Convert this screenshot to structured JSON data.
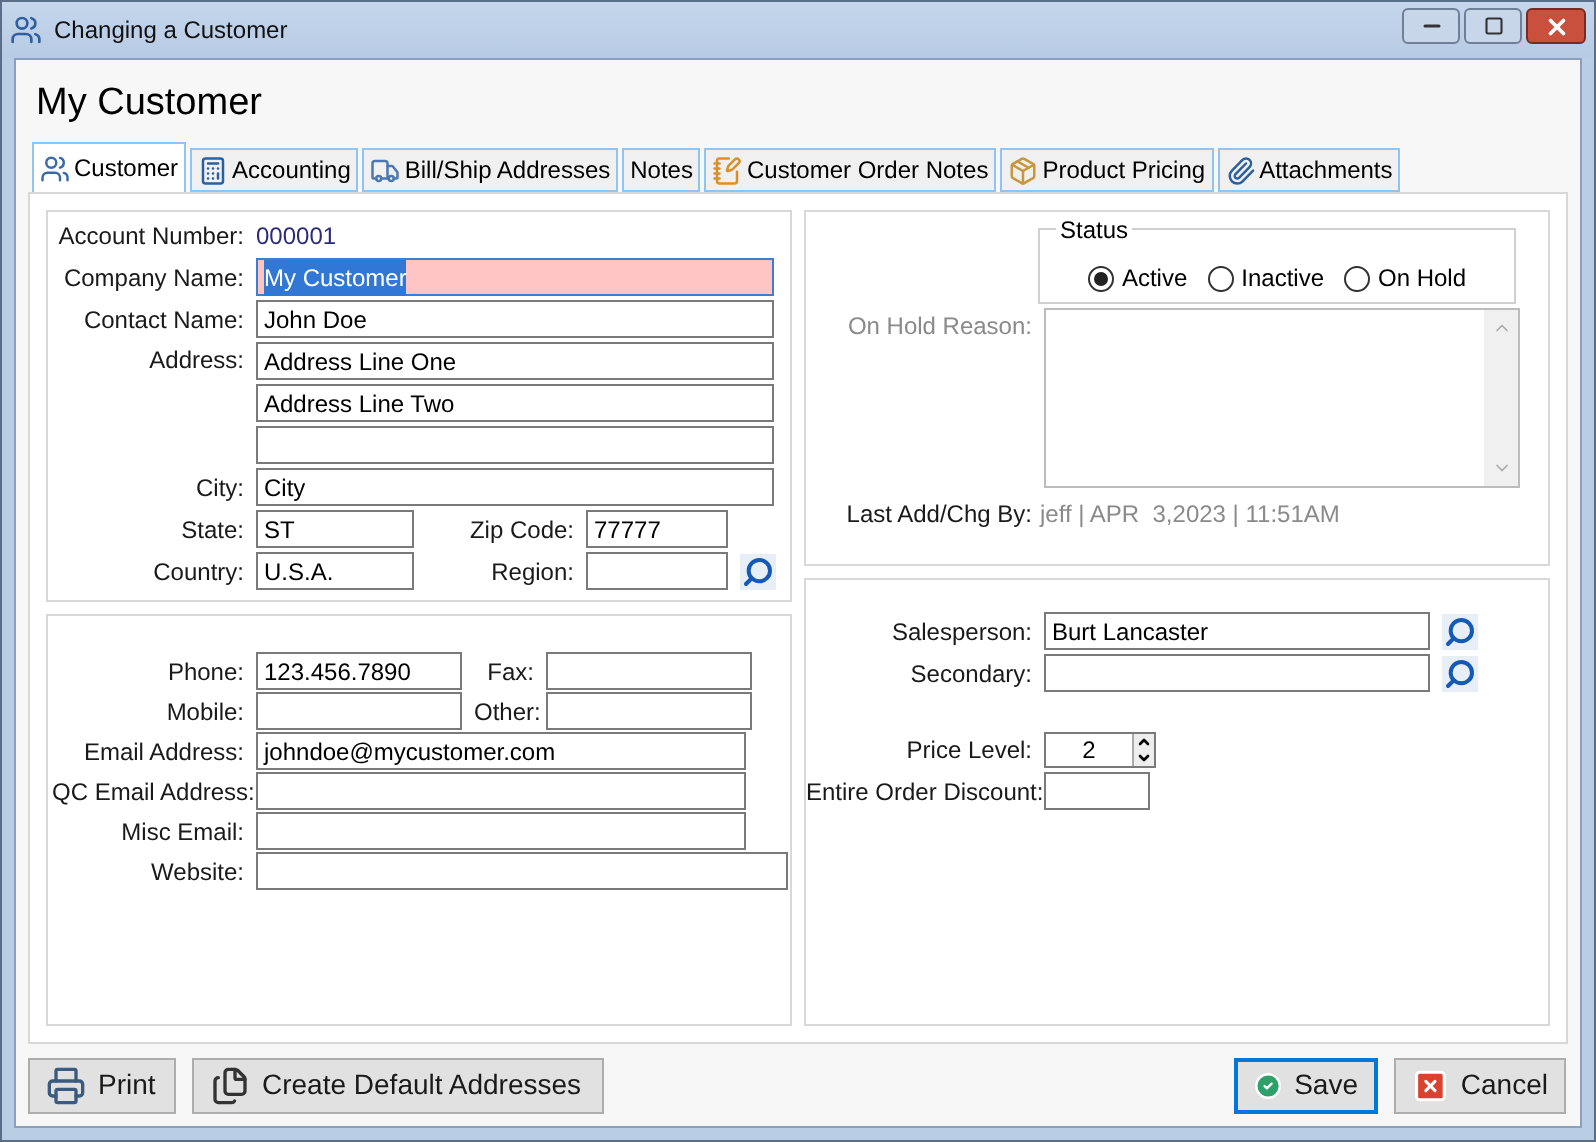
{
  "window": {
    "title": "Changing a Customer"
  },
  "heading": "My Customer",
  "tabs": [
    {
      "label": "Customer",
      "kind": "customer",
      "selected": true
    },
    {
      "label": "Accounting",
      "kind": "accounting",
      "selected": false
    },
    {
      "label": "Bill/Ship Addresses",
      "kind": "addresses",
      "selected": false
    },
    {
      "label": "Notes",
      "kind": "notes",
      "selected": false
    },
    {
      "label": "Customer Order Notes",
      "kind": "order_notes",
      "selected": false
    },
    {
      "label": "Product Pricing",
      "kind": "pricing",
      "selected": false
    },
    {
      "label": "Attachments",
      "kind": "attachments",
      "selected": false
    }
  ],
  "account": {
    "label": "Account Number:",
    "value": "000001"
  },
  "company": {
    "label": "Company Name:",
    "value": "My Customer",
    "focused": true
  },
  "contact": {
    "label": "Contact Name:",
    "value": "John Doe"
  },
  "address": {
    "label": "Address:",
    "lines": [
      {
        "value": "Address Line One"
      },
      {
        "value": "Address Line Two"
      }
    ]
  },
  "city": {
    "label": "City:",
    "value": "City"
  },
  "state": {
    "label": "State:",
    "value": "ST"
  },
  "zip": {
    "label": "Zip Code:",
    "value": "77777"
  },
  "country": {
    "label": "Country:",
    "value": "U.S.A."
  },
  "region": {
    "label": "Region:"
  },
  "phone": {
    "label": "Phone:",
    "value": "123.456.7890"
  },
  "fax": {
    "label": "Fax:"
  },
  "mobile": {
    "label": "Mobile:"
  },
  "other": {
    "label": "Other:"
  },
  "email": {
    "label": "Email Address:",
    "value": "johndoe@mycustomer.com"
  },
  "qc_email": {
    "label": "QC Email Address:"
  },
  "misc_email": {
    "label": "Misc Email:"
  },
  "website": {
    "label": "Website:"
  },
  "status": {
    "legend": "Status",
    "options": [
      {
        "label": "Active",
        "selected": true
      },
      {
        "label": "Inactive",
        "selected": false
      },
      {
        "label": "On Hold",
        "selected": false
      }
    ]
  },
  "on_hold_reason": {
    "label": "On Hold Reason:",
    "disabled": true
  },
  "last_change": {
    "label": "Last Add/Chg By:",
    "value": "jeff | APR  3,2023 | 11:51AM"
  },
  "salesperson": {
    "label": "Salesperson:",
    "value": "Burt Lancaster"
  },
  "secondary": {
    "label": "Secondary:"
  },
  "price_level": {
    "label": "Price Level:",
    "value": "2"
  },
  "discount": {
    "label": "Entire Order Discount:"
  },
  "buttons": [
    {
      "label": "Print",
      "kind": "print",
      "focused": false
    },
    {
      "label": "Create Default Addresses",
      "kind": "addresses",
      "focused": false
    },
    {
      "label": "Save",
      "kind": "save",
      "focused": true
    },
    {
      "label": "Cancel",
      "kind": "cancel",
      "focused": false
    }
  ]
}
